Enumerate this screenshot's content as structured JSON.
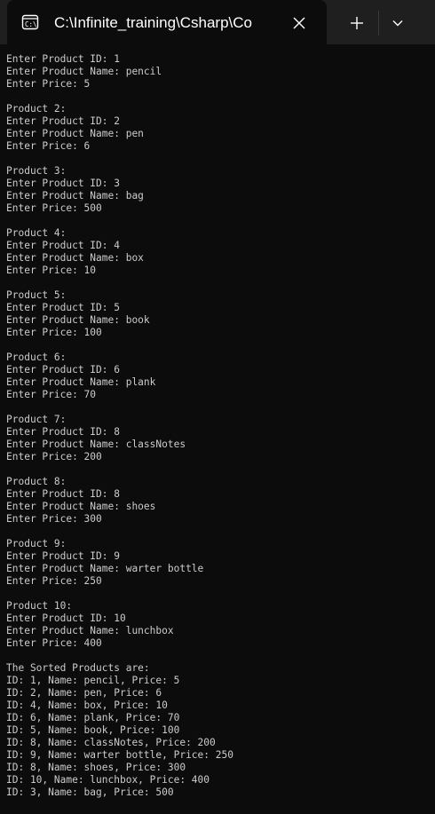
{
  "tab": {
    "title": "C:\\Infinite_training\\Csharp\\Co",
    "icon": "console-icon"
  },
  "controls": {
    "close_icon": "close-icon",
    "new_tab_icon": "plus-icon",
    "dropdown_icon": "chevron-down-icon"
  },
  "console": {
    "lines": [
      "Enter Product ID: 1",
      "Enter Product Name: pencil",
      "Enter Price: 5",
      "",
      "Product 2:",
      "Enter Product ID: 2",
      "Enter Product Name: pen",
      "Enter Price: 6",
      "",
      "Product 3:",
      "Enter Product ID: 3",
      "Enter Product Name: bag",
      "Enter Price: 500",
      "",
      "Product 4:",
      "Enter Product ID: 4",
      "Enter Product Name: box",
      "Enter Price: 10",
      "",
      "Product 5:",
      "Enter Product ID: 5",
      "Enter Product Name: book",
      "Enter Price: 100",
      "",
      "Product 6:",
      "Enter Product ID: 6",
      "Enter Product Name: plank",
      "Enter Price: 70",
      "",
      "Product 7:",
      "Enter Product ID: 8",
      "Enter Product Name: classNotes",
      "Enter Price: 200",
      "",
      "Product 8:",
      "Enter Product ID: 8",
      "Enter Product Name: shoes",
      "Enter Price: 300",
      "",
      "Product 9:",
      "Enter Product ID: 9",
      "Enter Product Name: warter bottle",
      "Enter Price: 250",
      "",
      "Product 10:",
      "Enter Product ID: 10",
      "Enter Product Name: lunchbox",
      "Enter Price: 400",
      "",
      "The Sorted Products are:",
      "ID: 1, Name: pencil, Price: 5",
      "ID: 2, Name: pen, Price: 6",
      "ID: 4, Name: box, Price: 10",
      "ID: 6, Name: plank, Price: 70",
      "ID: 5, Name: book, Price: 100",
      "ID: 8, Name: classNotes, Price: 200",
      "ID: 9, Name: warter bottle, Price: 250",
      "ID: 8, Name: shoes, Price: 300",
      "ID: 10, Name: lunchbox, Price: 400",
      "ID: 3, Name: bag, Price: 500"
    ]
  }
}
